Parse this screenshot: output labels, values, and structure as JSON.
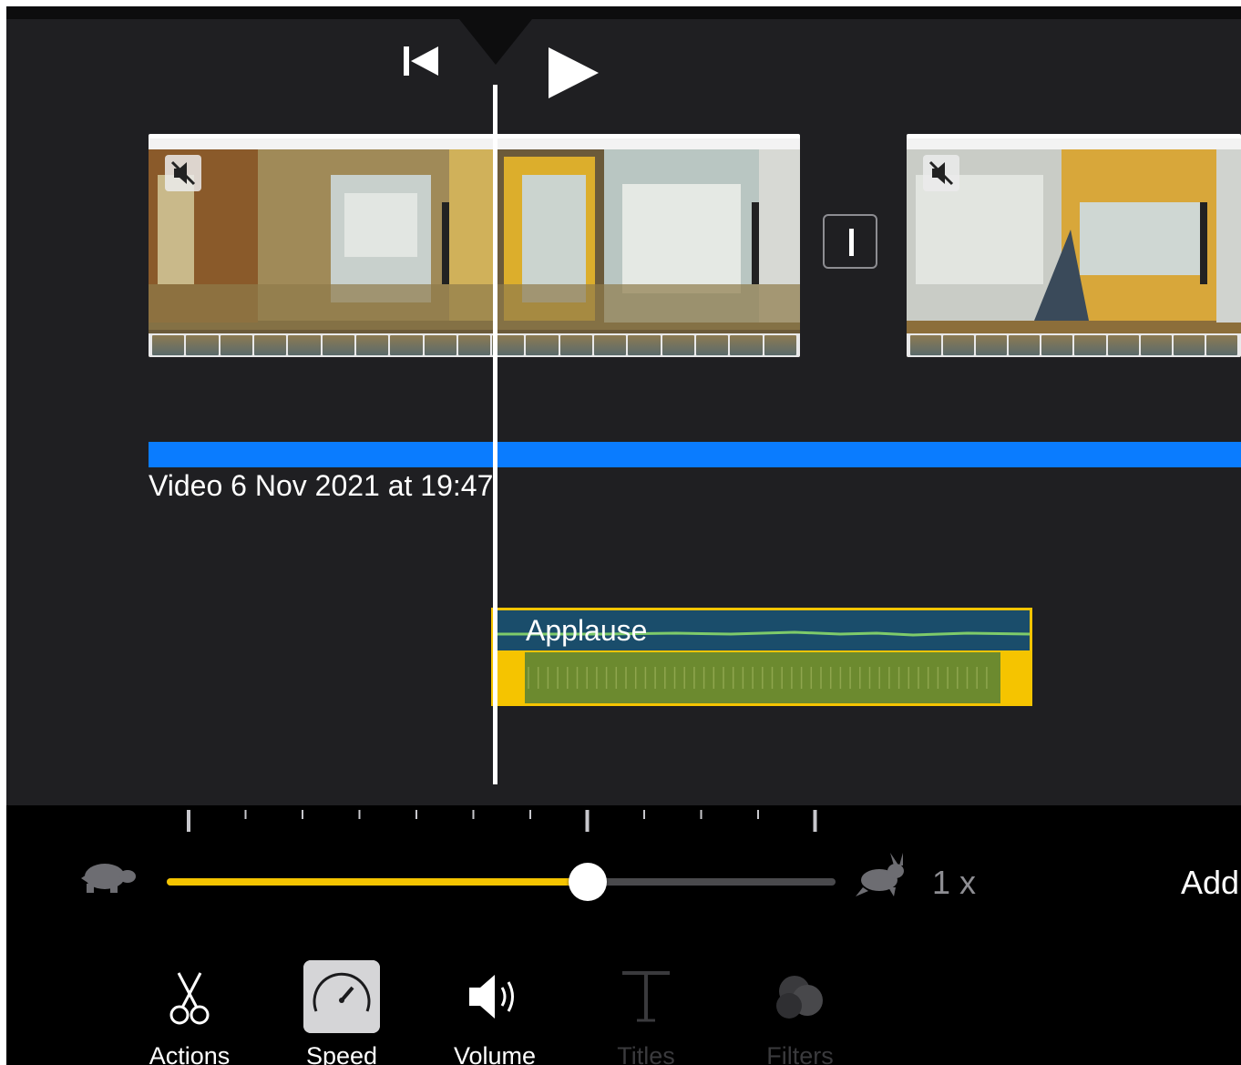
{
  "editor": {
    "clip_label": "Video 6 Nov 2021 at 19:47",
    "audio_clip_title": "Applause",
    "colors": {
      "accent_blue": "#0a7cff",
      "audio_yellow": "#f5c400",
      "background": "#1f1f22"
    }
  },
  "transport": {
    "skip_icon": "skip-to-start-icon",
    "play_icon": "play-icon"
  },
  "speed_control": {
    "value_fraction": 0.63,
    "readout": "1 x",
    "slow_icon": "turtle-icon",
    "fast_icon": "hare-icon",
    "side_action": "Add"
  },
  "toolbar": {
    "items": [
      {
        "label": "Actions",
        "icon": "scissors-icon",
        "state": "enabled"
      },
      {
        "label": "Speed",
        "icon": "speedometer-icon",
        "state": "selected"
      },
      {
        "label": "Volume",
        "icon": "speaker-icon",
        "state": "enabled"
      },
      {
        "label": "Titles",
        "icon": "text-t-icon",
        "state": "disabled"
      },
      {
        "label": "Filters",
        "icon": "filters-circles-icon",
        "state": "disabled"
      }
    ]
  }
}
